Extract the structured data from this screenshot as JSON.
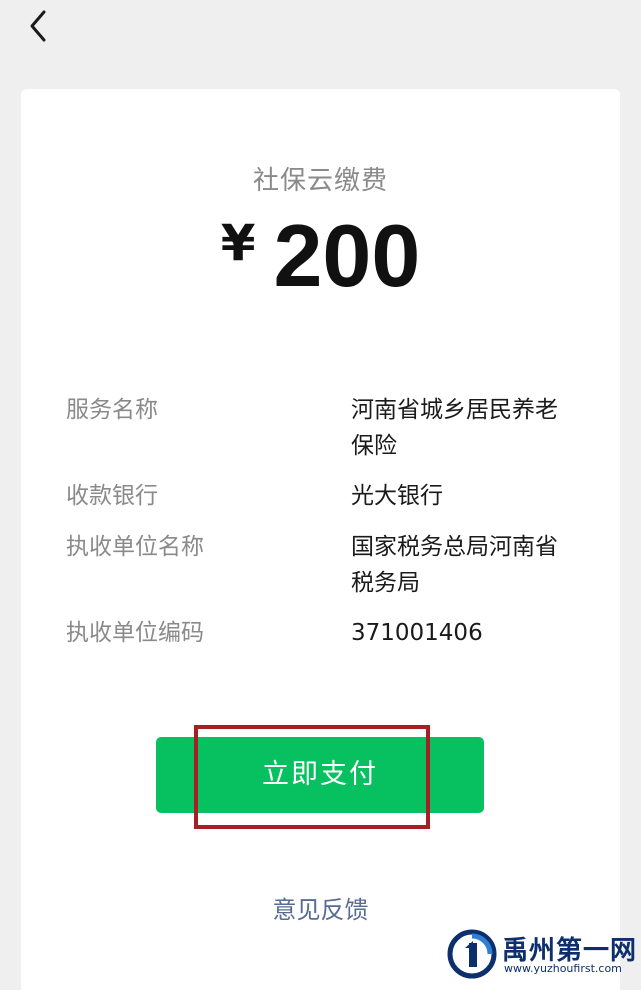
{
  "nav": {
    "back_icon": "chevron-left-icon"
  },
  "payment": {
    "merchant": "社保云缴费",
    "currency_symbol": "¥",
    "amount": "200"
  },
  "details": [
    {
      "label": "服务名称",
      "value_line1": "河南省城乡居民养老",
      "value_line2": "保险"
    },
    {
      "label": "收款银行",
      "value_line1": "光大银行",
      "value_line2": ""
    },
    {
      "label": "执收单位名称",
      "value_line1": "国家税务总局河南省",
      "value_line2": "税务局"
    },
    {
      "label": "执收单位编码",
      "value_line1": "371001406",
      "value_line2": ""
    }
  ],
  "actions": {
    "pay_label": "立即支付",
    "feedback_label": "意见反馈"
  },
  "colors": {
    "primary_green": "#07c160",
    "highlight_red": "#a51f23",
    "link_blue": "#576b95",
    "background": "#efefef"
  },
  "watermark": {
    "name": "禹州第一网",
    "url": "www.yuzhoufirst.com"
  }
}
